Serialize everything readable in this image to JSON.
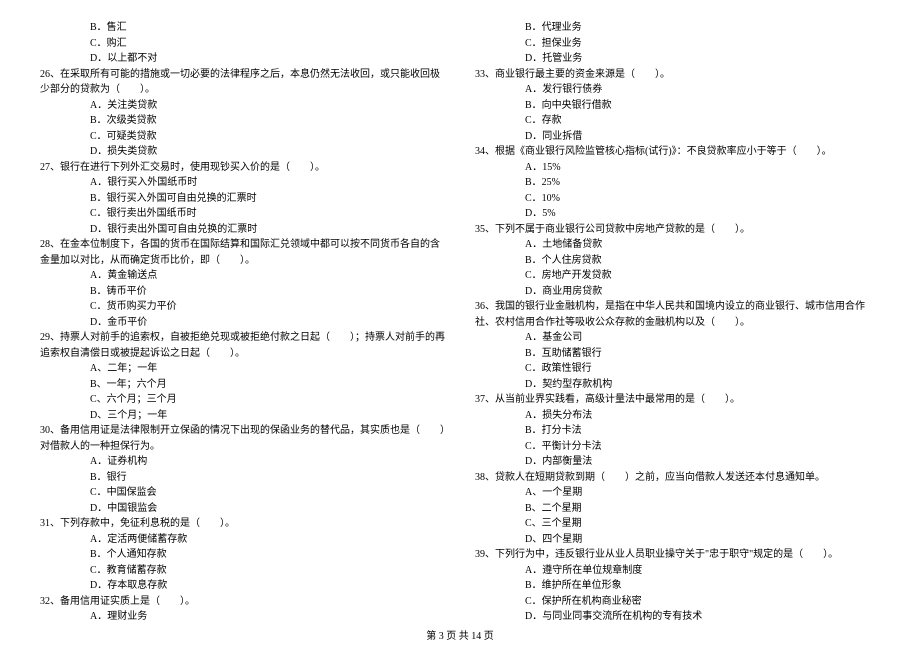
{
  "left": {
    "pre_opts": [
      "B．售汇",
      "C．购汇",
      "D．以上都不对"
    ],
    "q26": "26、在采取所有可能的措施或一切必要的法律程序之后，本息仍然无法收回，或只能收回极少部分的贷款为（　　）。",
    "q26_opts": [
      "A．关注类贷款",
      "B．次级类贷款",
      "C．可疑类贷款",
      "D．损失类贷款"
    ],
    "q27": "27、银行在进行下列外汇交易时，使用现钞买入价的是（　　）。",
    "q27_opts": [
      "A．银行买入外国纸币时",
      "B．银行买入外国可自由兑换的汇票时",
      "C．银行卖出外国纸币时",
      "D．银行卖出外国可自由兑换的汇票时"
    ],
    "q28": "28、在金本位制度下，各国的货币在国际结算和国际汇兑领域中都可以按不同货币各自的含金量加以对比，从而确定货币比价，即（　　）。",
    "q28_opts": [
      "A．黄金输送点",
      "B．铸币平价",
      "C．货币购买力平价",
      "D．金币平价"
    ],
    "q29": "29、持票人对前手的追索权，自被拒绝兑现或被拒绝付款之日起（　　）；持票人对前手的再追索权自清偿日或被提起诉讼之日起（　　）。",
    "q29_opts": [
      "A、二年；一年",
      "B、一年；六个月",
      "C、六个月；三个月",
      "D、三个月；一年"
    ],
    "q30": "30、备用信用证是法律限制开立保函的情况下出现的保函业务的替代品，其实质也是（　　）对借款人的一种担保行为。",
    "q30_opts": [
      "A．证券机构",
      "B．银行",
      "C．中国保监会",
      "D．中国银监会"
    ],
    "q31": "31、下列存款中，免征利息税的是（　　）。",
    "q31_opts": [
      "A．定活两便储蓄存款",
      "B．个人通知存款",
      "C．教育储蓄存款",
      "D．存本取息存款"
    ],
    "q32": "32、备用信用证实质上是（　　）。",
    "q32_opts": [
      "A．理财业务"
    ]
  },
  "right": {
    "pre_opts": [
      "B．代理业务",
      "C．担保业务",
      "D．托管业务"
    ],
    "q33": "33、商业银行最主要的资金来源是（　　）。",
    "q33_opts": [
      "A．发行银行债券",
      "B．向中央银行借款",
      "C．存款",
      "D．同业拆借"
    ],
    "q34": "34、根据《商业银行风险监管核心指标(试行)》：不良贷款率应小于等于（　　）。",
    "q34_opts": [
      "A．15%",
      "B．25%",
      "C．10%",
      "D．5%"
    ],
    "q35": "35、下列不属于商业银行公司贷款中房地产贷款的是（　　）。",
    "q35_opts": [
      "A．土地储备贷款",
      "B．个人住房贷款",
      "C．房地产开发贷款",
      "D．商业用房贷款"
    ],
    "q36": "36、我国的银行业金融机构，是指在中华人民共和国境内设立的商业银行、城市信用合作社、农村信用合作社等吸收公众存款的金融机构以及（　　）。",
    "q36_opts": [
      "A．基金公司",
      "B．互助储蓄银行",
      "C．政策性银行",
      "D．契约型存款机构"
    ],
    "q37": "37、从当前业界实践看，高级计量法中最常用的是（　　）。",
    "q37_opts": [
      "A．损失分布法",
      "B．打分卡法",
      "C．平衡计分卡法",
      "D．内部衡量法"
    ],
    "q38": "38、贷款人在短期贷款到期（　　）之前，应当向借款人发送还本付息通知单。",
    "q38_opts": [
      "A、一个星期",
      "B、二个星期",
      "C、三个星期",
      "D、四个星期"
    ],
    "q39": "39、下列行为中，违反银行业从业人员职业操守关于\"忠于职守\"规定的是（　　）。",
    "q39_opts": [
      "A．遵守所在单位规章制度",
      "B．维护所在单位形象",
      "C．保护所在机构商业秘密",
      "D．与同业同事交流所在机构的专有技术"
    ]
  },
  "footer": "第 3 页 共 14 页"
}
